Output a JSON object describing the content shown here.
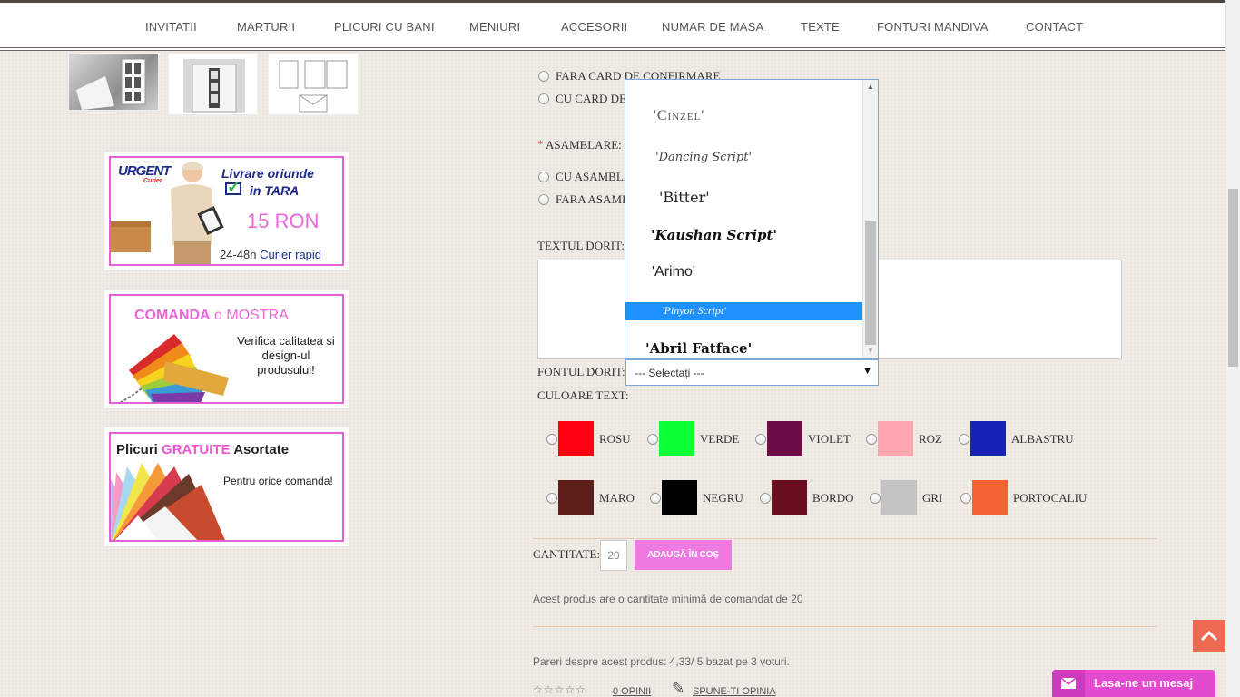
{
  "nav": {
    "items": [
      "INVITATII",
      "MARTURII",
      "PLICURI CU BANI",
      "MENIURI",
      "ACCESORII",
      "NUMAR DE MASA",
      "TEXTE",
      "FONTURI MANDIVA",
      "CONTACT"
    ]
  },
  "banners": {
    "delivery": {
      "logo": "URGENT",
      "logo_sub": "Curier",
      "line1": "Livrare oriunde",
      "line2": "in TARA",
      "price": "15 RON",
      "footer_a": "24-48h",
      "footer_b": "Curier rapid"
    },
    "sample": {
      "title_a": "COMANDA",
      "title_b": "o",
      "title_c": "MOSTRA",
      "text_1": "Verifica calitatea si",
      "text_2": "design-ul",
      "text_3": "produsului!"
    },
    "envelopes": {
      "title_a": "Plicuri",
      "title_b": "GRATUITE",
      "title_c": "Asortate",
      "text": "Pentru orice comanda!"
    }
  },
  "form": {
    "confirm_card_options": [
      "FARA CARD DE CONFIRMARE",
      "CU CARD DE"
    ],
    "assembly_required": "*",
    "assembly_label": "ASAMBLARE:",
    "assembly_options": [
      "CU ASAMBLA",
      "FARA ASAMB"
    ],
    "text_label": "TEXTUL DORIT:",
    "font_label": "FONTUL DORIT:",
    "font_select_value": "--- Selectați ---",
    "font_options": [
      "'Cinzel'",
      "'Dancing Script'",
      "'Bitter'",
      "'Kaushan Script'",
      "'Arimo'",
      "'Pinyon Script'",
      "'Abril Fatface'"
    ],
    "font_selected_index": 5,
    "color_label": "CULOARE TEXT:",
    "colors": [
      {
        "name": "ROSU",
        "hex": "#ff0010"
      },
      {
        "name": "VERDE",
        "hex": "#0dff36"
      },
      {
        "name": "VIOLET",
        "hex": "#6a0d48"
      },
      {
        "name": "ROZ",
        "hex": "#ffa5ae"
      },
      {
        "name": "ALBASTRU",
        "hex": "#1523b6"
      },
      {
        "name": "MARO",
        "hex": "#5e1e19"
      },
      {
        "name": "NEGRU",
        "hex": "#000000"
      },
      {
        "name": "BORDO",
        "hex": "#6a0f1f"
      },
      {
        "name": "GRI",
        "hex": "#c4c4c4"
      },
      {
        "name": "PORTOCALIU",
        "hex": "#f36232"
      }
    ],
    "quantity_label": "CANTITATE:",
    "quantity_value": "20",
    "add_to_cart": "ADAUGĂ ÎN COȘ",
    "min_qty_note": "Acest produs are o cantitate minimă de comandat de 20",
    "reviews_summary": "Pareri despre acest produs: 4,33/ 5 bazat pe 3 voturi.",
    "stars": "☆☆☆☆☆",
    "opinions_link": "0 OPINII",
    "write_review_link": "SPUNE-TI OPINIA"
  },
  "widgets": {
    "chat_label": "Lasa-ne un mesaj",
    "to_top_icon": "chevron-up-icon",
    "chat_icon": "envelope-icon"
  }
}
